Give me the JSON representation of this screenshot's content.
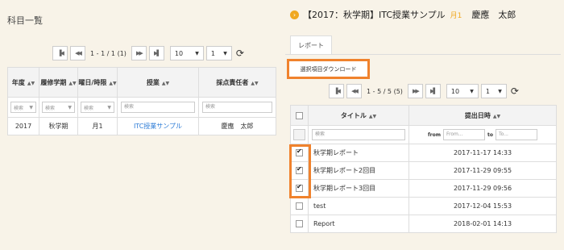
{
  "left": {
    "title": "科目一覧",
    "pager": {
      "first": "▐◀",
      "prev": "◀◀",
      "info": "1 - 1 / 1 (1)",
      "next": "▶▶",
      "last": "▶▌",
      "per_page": "10",
      "page": "1"
    },
    "columns": [
      "年度",
      "履修学期",
      "曜日/時限",
      "授業",
      "採点責任者"
    ],
    "filters": {
      "year": "検索",
      "term": "検索",
      "day": "検索",
      "course": "検索",
      "grader": "検索"
    },
    "rows": [
      {
        "year": "2017",
        "term": "秋学期",
        "day": "月1",
        "course": "ITC授業サンプル",
        "grader": "慶應　太郎"
      }
    ]
  },
  "right": {
    "header": {
      "course": "【2017：秋学期】ITC授業サンプル",
      "term": "月1",
      "teacher": "慶應　太郎"
    },
    "tab": "レポート",
    "download_button": "選択項目ダウンロード",
    "pager": {
      "info": "1 - 5 / 5 (5)",
      "per_page": "10",
      "page": "1"
    },
    "columns": {
      "title": "タイトル",
      "date": "提出日時"
    },
    "filters": {
      "title": "検索",
      "from_label": "from",
      "from_placeholder": "From...",
      "to_label": "to",
      "to_placeholder": "To..."
    },
    "rows": [
      {
        "title": "秋学期レポート",
        "date": "2017-11-17 14:33",
        "checked": true
      },
      {
        "title": "秋学期レポート2回目",
        "date": "2017-11-29 09:55",
        "checked": true
      },
      {
        "title": "秋学期レポート3回目",
        "date": "2017-11-29 09:56",
        "checked": true
      },
      {
        "title": "test",
        "date": "2017-12-04 15:53",
        "checked": false
      },
      {
        "title": "Report",
        "date": "2018-02-01 14:13",
        "checked": false
      }
    ]
  },
  "colors": {
    "accent_orange": "#f0822d",
    "term_orange": "#f0a820",
    "link_blue": "#2b7bd6"
  }
}
